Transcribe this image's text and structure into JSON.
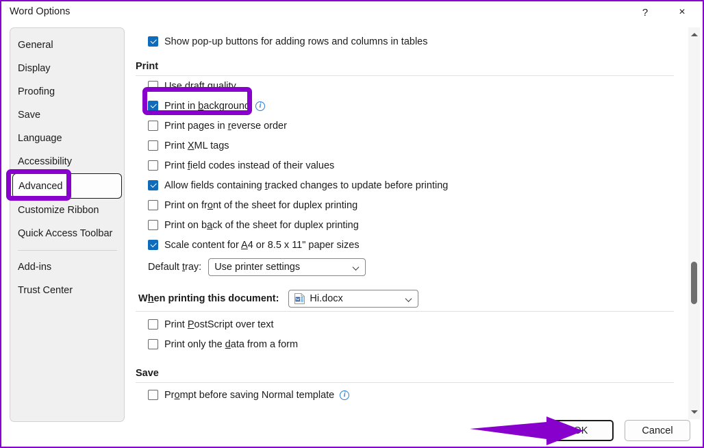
{
  "window": {
    "title": "Word Options",
    "help_label": "?",
    "close_label": "×",
    "border_color": "#8800cc"
  },
  "sidebar": {
    "items": [
      {
        "label": "General",
        "selected": false
      },
      {
        "label": "Display",
        "selected": false
      },
      {
        "label": "Proofing",
        "selected": false
      },
      {
        "label": "Save",
        "selected": false
      },
      {
        "label": "Language",
        "selected": false
      },
      {
        "label": "Accessibility",
        "selected": false
      },
      {
        "label": "Advanced",
        "selected": true
      },
      {
        "label": "Customize Ribbon",
        "selected": false
      },
      {
        "label": "Quick Access Toolbar",
        "selected": false
      },
      {
        "label": "Add-ins",
        "selected": false
      },
      {
        "label": "Trust Center",
        "selected": false
      }
    ]
  },
  "main": {
    "top_option": {
      "label_pre": "Show pop-up buttons for adding rows and columns in tables",
      "checked": true
    },
    "print_section": {
      "heading": "Print",
      "options": [
        {
          "pre": "Use draft ",
          "mn": "q",
          "post": "uality",
          "checked": false,
          "info": false
        },
        {
          "pre": "Print in ",
          "mn": "b",
          "post": "ackground",
          "checked": true,
          "info": true
        },
        {
          "pre": "Print pages in ",
          "mn": "r",
          "post": "everse order",
          "checked": false,
          "info": false
        },
        {
          "pre": "Print ",
          "mn": "X",
          "post": "ML tags",
          "checked": false,
          "info": false
        },
        {
          "pre": "Print ",
          "mn": "f",
          "post": "ield codes instead of their values",
          "checked": false,
          "info": false
        },
        {
          "pre": "Allow fields containing ",
          "mn": "t",
          "post": "racked changes to update before printing",
          "checked": true,
          "info": false
        },
        {
          "pre": "Print on fr",
          "mn": "o",
          "post": "nt of the sheet for duplex printing",
          "checked": false,
          "info": false
        },
        {
          "pre": "Print on b",
          "mn": "a",
          "post": "ck of the sheet for duplex printing",
          "checked": false,
          "info": false
        },
        {
          "pre": "Scale content for ",
          "mn": "A",
          "post": "4 or 8.5 x 11\" paper sizes",
          "checked": true,
          "info": false
        }
      ],
      "default_tray": {
        "label_pre": "Default ",
        "label_mn": "t",
        "label_post": "ray:",
        "value": "Use printer settings"
      }
    },
    "when_printing": {
      "label_pre": "W",
      "label_mn": "h",
      "label_post": "en printing this document:",
      "value": "Hi.docx",
      "options": [
        {
          "pre": "Print ",
          "mn": "P",
          "post": "ostScript over text",
          "checked": false,
          "info": false
        },
        {
          "pre": "Print only the ",
          "mn": "d",
          "post": "ata from a form",
          "checked": false,
          "info": false
        }
      ]
    },
    "save_section": {
      "heading": "Save",
      "options": [
        {
          "pre": "Pr",
          "mn": "o",
          "post": "mpt before saving Normal template",
          "checked": false,
          "info": true
        }
      ]
    }
  },
  "footer": {
    "ok_label": "OK",
    "cancel_label": "Cancel"
  },
  "scrollbar": {
    "up_arrow": "up-arrow",
    "down_arrow": "down-arrow"
  },
  "annotations": {
    "color": "#8800cc",
    "items": [
      {
        "name": "highlight-use-draft-quality",
        "shape": "rect"
      },
      {
        "name": "highlight-advanced-nav",
        "shape": "rect"
      },
      {
        "name": "arrow-to-ok-button",
        "shape": "arrow"
      }
    ]
  }
}
